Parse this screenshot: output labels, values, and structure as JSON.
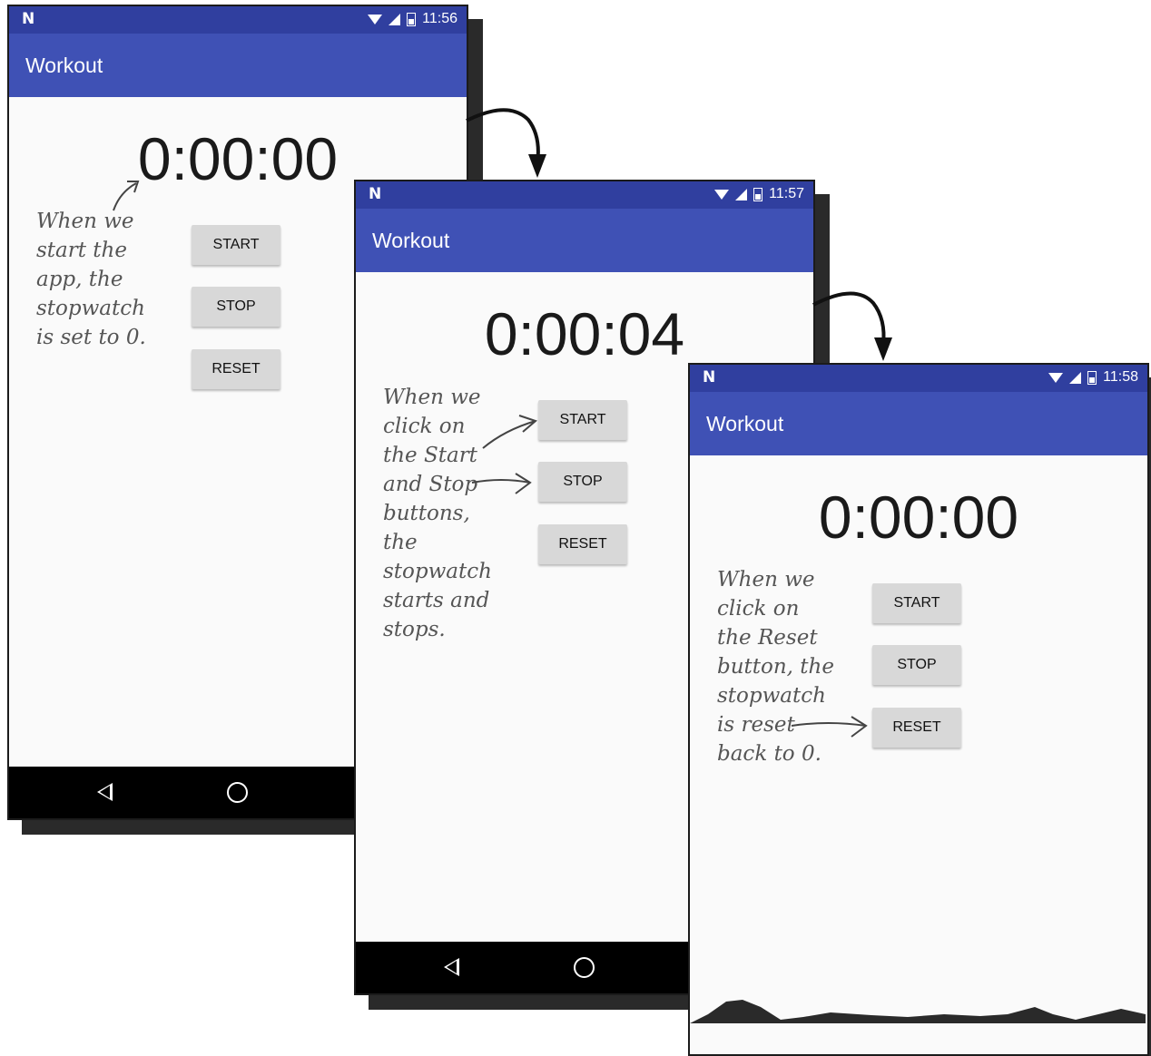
{
  "screens": [
    {
      "status_time": "11:56",
      "app_title": "Workout",
      "timer": "0:00:00",
      "buttons": {
        "start": "START",
        "stop": "STOP",
        "reset": "RESET"
      },
      "annotation": "When we\nstart the\napp, the\nstopwatch\nis set to 0."
    },
    {
      "status_time": "11:57",
      "app_title": "Workout",
      "timer": "0:00:04",
      "buttons": {
        "start": "START",
        "stop": "STOP",
        "reset": "RESET"
      },
      "annotation": "When we\nclick on\nthe Start\nand Stop\nbuttons,\nthe\nstopwatch\nstarts and\nstops."
    },
    {
      "status_time": "11:58",
      "app_title": "Workout",
      "timer": "0:00:00",
      "buttons": {
        "start": "START",
        "stop": "STOP",
        "reset": "RESET"
      },
      "annotation": "When we\nclick on\nthe Reset\nbutton, the\nstopwatch\nis reset\nback to 0."
    }
  ],
  "colors": {
    "status_bar": "#303f9f",
    "toolbar": "#3f51b5",
    "button": "#d8d8d8",
    "screen_background": "#fafafa",
    "nav_bar": "#000000"
  },
  "icons": [
    "n-logo-icon",
    "wifi-icon",
    "signal-icon",
    "battery-icon",
    "back-icon",
    "home-icon"
  ]
}
